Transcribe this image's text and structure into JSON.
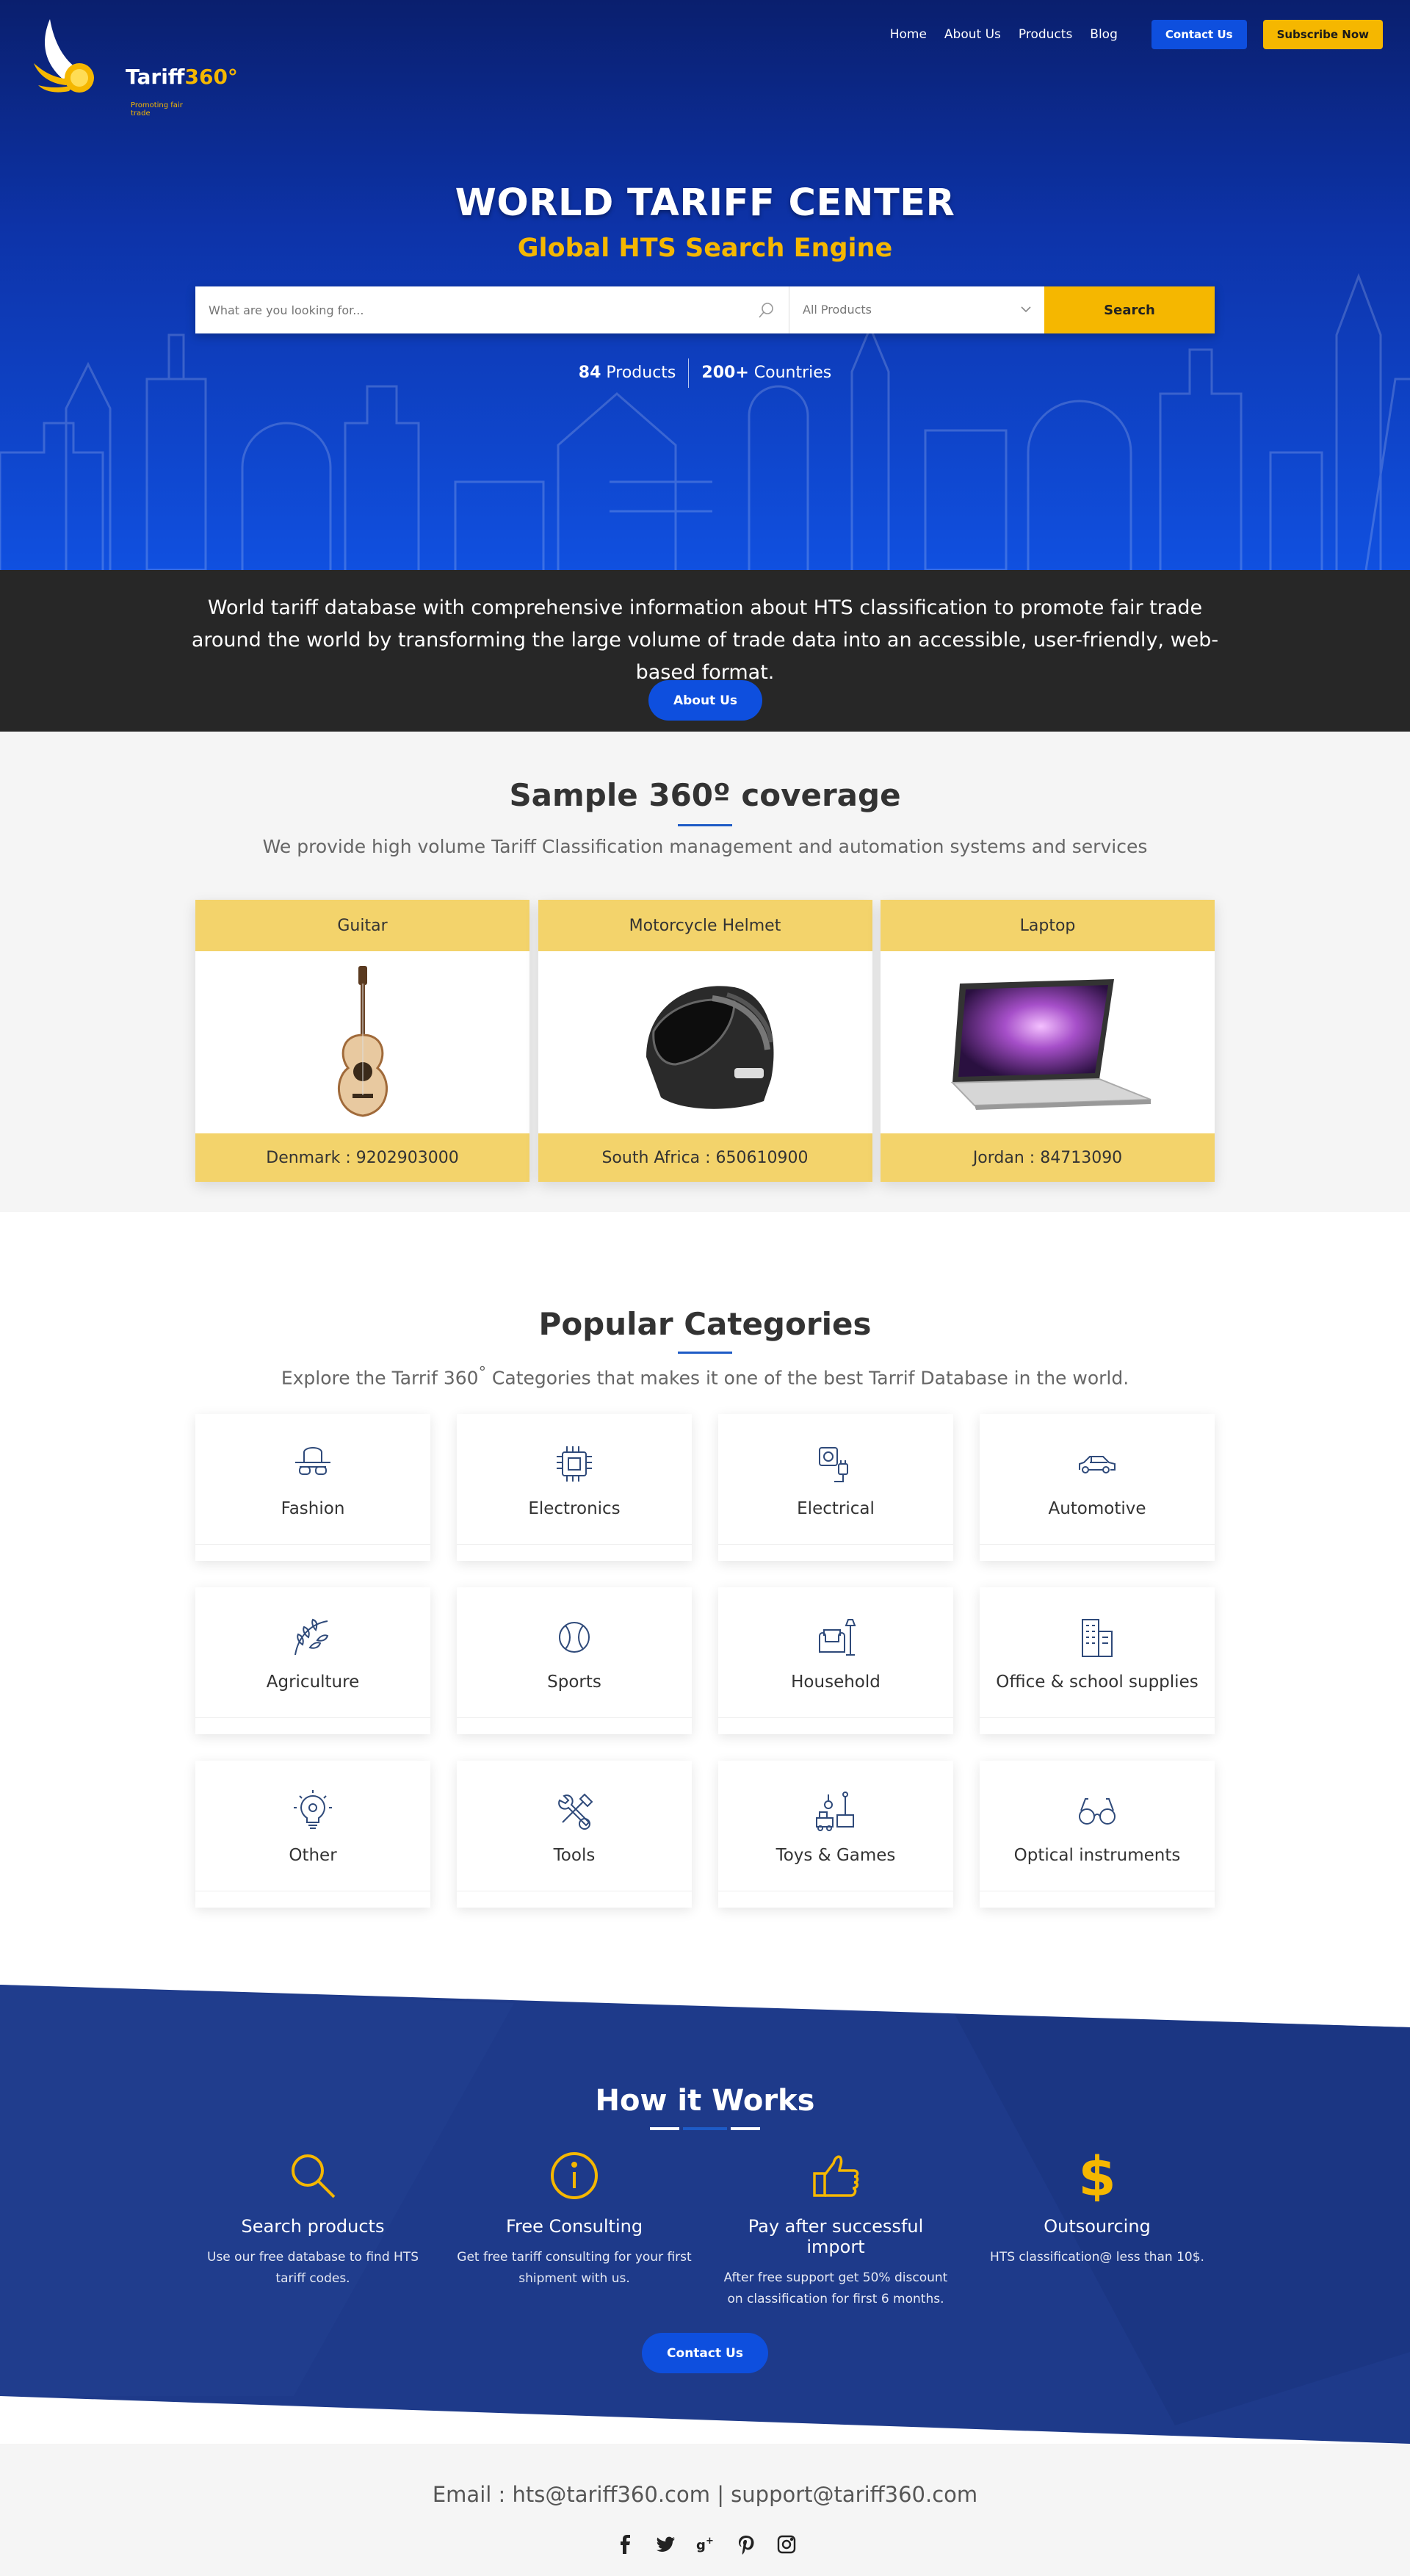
{
  "brand": {
    "name": "Tariff",
    "name_deg": "360°",
    "tagline": "Promoting fair trade"
  },
  "nav": {
    "links": [
      "Home",
      "About Us",
      "Products",
      "Blog"
    ],
    "contact_label": "Contact Us",
    "subscribe_label": "Subscribe Now"
  },
  "hero": {
    "title": "WORLD TARIFF CENTER",
    "subtitle": "Global HTS Search Engine",
    "search_placeholder": "What are you looking for...",
    "select_value": "All Products",
    "search_button": "Search",
    "stats": [
      {
        "num": "84",
        "label": " Products"
      },
      {
        "num": "200+",
        "label": " Countries"
      }
    ]
  },
  "intro": {
    "text": "World tariff database with comprehensive information about HTS classification to promote fair trade around the world by transforming the large volume of trade data into an accessible, user-friendly, web-based format.",
    "button": "About Us"
  },
  "sample": {
    "title": "Sample 360º coverage",
    "subtitle": "We provide high volume Tariff Classification management and automation systems and services",
    "cards": [
      {
        "name": "Guitar",
        "code": "Denmark : 9202903000"
      },
      {
        "name": "Motorcycle Helmet",
        "code": "South Africa : 650610900"
      },
      {
        "name": "Laptop",
        "code": "Jordan : 84713090"
      }
    ]
  },
  "categories": {
    "title": "Popular Categories",
    "subtitle_pre": "Explore the Tarrif 360",
    "subtitle_sup": "°",
    "subtitle_post": " Categories that makes it one of the best Tarrif Database in the world.",
    "items": [
      {
        "label": "Fashion",
        "icon": "hat-glasses-icon"
      },
      {
        "label": "Electronics",
        "icon": "chip-icon"
      },
      {
        "label": "Electrical",
        "icon": "socket-plug-icon"
      },
      {
        "label": "Automotive",
        "icon": "car-icon"
      },
      {
        "label": "Agriculture",
        "icon": "wheat-icon"
      },
      {
        "label": "Sports",
        "icon": "baseball-icon"
      },
      {
        "label": "Household",
        "icon": "armchair-lamp-icon"
      },
      {
        "label": "Office & school supplies",
        "icon": "office-building-icon"
      },
      {
        "label": "Other",
        "icon": "lightbulb-icon"
      },
      {
        "label": "Tools",
        "icon": "wrench-hammer-icon"
      },
      {
        "label": "Toys & Games",
        "icon": "toys-icon"
      },
      {
        "label": "Optical instruments",
        "icon": "eyeglasses-icon"
      }
    ]
  },
  "how": {
    "title": "How it Works",
    "steps": [
      {
        "title": "Search products",
        "text": "Use our free database to find HTS tariff codes.",
        "icon": "magnifier-icon"
      },
      {
        "title": "Free Consulting",
        "text": "Get free tariff consulting for your first shipment with us.",
        "icon": "info-icon"
      },
      {
        "title": "Pay after successful import",
        "text": "After free support get 50% discount on classification for first 6 months.",
        "icon": "thumbs-up-icon"
      },
      {
        "title": "Outsourcing",
        "text": "HTS classification@ less than 10$.",
        "icon": "dollar-icon"
      }
    ],
    "button": "Contact Us"
  },
  "footer": {
    "email": "Email : hts@tariff360.com | support@tariff360.com",
    "socials": [
      "facebook-icon",
      "twitter-icon",
      "googleplus-icon",
      "pinterest-icon",
      "instagram-icon"
    ]
  },
  "colors": {
    "primary_blue": "#0e4fde",
    "accent_yellow": "#f5b700",
    "card_yellow": "#f3d36b",
    "dark_band": "#272727",
    "navy": "#1e3a8a"
  }
}
